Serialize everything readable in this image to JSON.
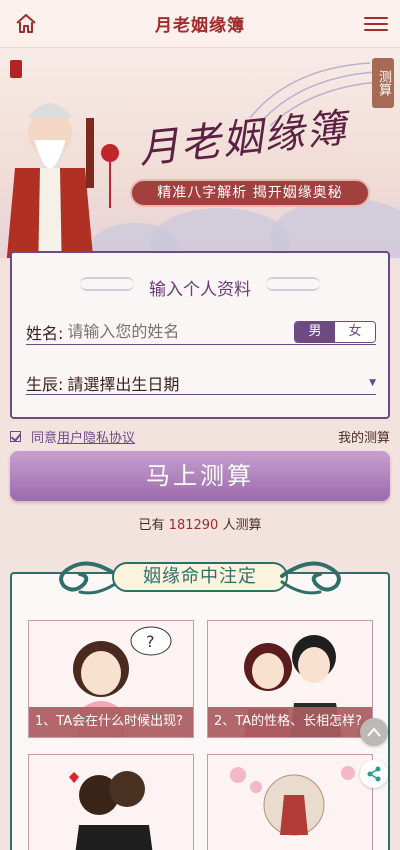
{
  "topbar": {
    "title": "月老姻缘簿",
    "home_icon": "home-icon",
    "menu_icon": "menu-icon"
  },
  "hero": {
    "title": "月老姻缘簿",
    "subtitle": "精准八字解析  揭开姻缘奥秘",
    "side_tag": "测算"
  },
  "form": {
    "heading": "输入个人资料",
    "name_label": "姓名:",
    "name_placeholder": "请输入您的姓名",
    "gender_male": "男",
    "gender_female": "女",
    "gender_selected": "男",
    "birth_label": "生辰:",
    "birth_value": "請選擇出生日期"
  },
  "agreement": {
    "prefix": "同意",
    "link": "用户隐私协议",
    "my_test": "我的测算"
  },
  "submit_label": "马上测算",
  "count": {
    "prefix": "已有 ",
    "number": "181290",
    "suffix": " 人测算"
  },
  "section": {
    "title": "姻缘命中注定",
    "tiles": [
      {
        "caption": "1、TA会在什么时候出现?"
      },
      {
        "caption": "2、TA的性格、长相怎样?"
      },
      {
        "caption": ""
      },
      {
        "caption": ""
      }
    ]
  },
  "colors": {
    "primary": "#6d4a80",
    "accent_red": "#a12c2c",
    "teal": "#2f6f6a",
    "button": "#b285bf"
  }
}
